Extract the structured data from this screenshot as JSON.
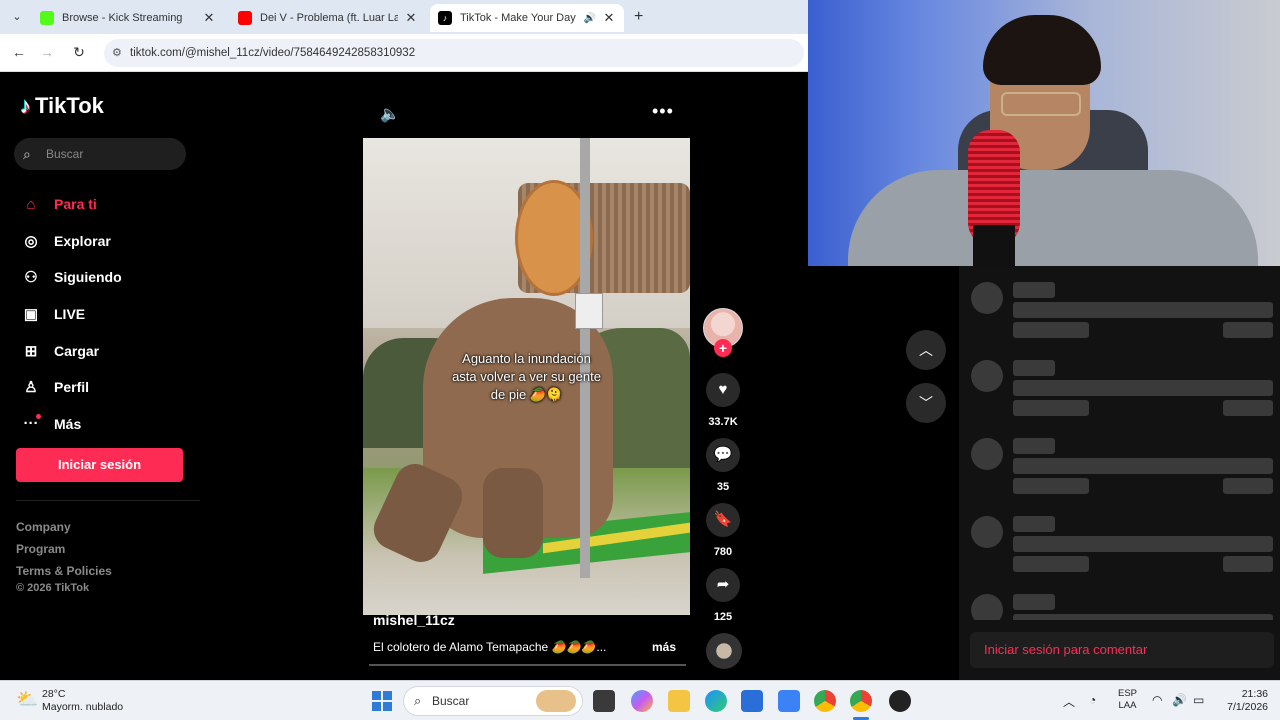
{
  "browser": {
    "tabs": [
      {
        "title": "Browse - Kick Streaming",
        "favicon_color": "#53fc18"
      },
      {
        "title": "Dei V - Problema (ft. Luar La L)",
        "favicon_color": "#ff0000"
      },
      {
        "title": "TikTok - Make Your Day",
        "favicon_color": "#000000",
        "active": true
      }
    ],
    "url": "tiktok.com/@mishel_11cz/video/7584649242858310932"
  },
  "tiktok": {
    "logo": "TikTok",
    "search_placeholder": "Buscar",
    "nav": [
      {
        "label": "Para ti",
        "icon": "home-icon",
        "active": true
      },
      {
        "label": "Explorar",
        "icon": "compass-icon"
      },
      {
        "label": "Siguiendo",
        "icon": "following-icon"
      },
      {
        "label": "LIVE",
        "icon": "live-icon"
      },
      {
        "label": "Cargar",
        "icon": "upload-icon"
      },
      {
        "label": "Perfil",
        "icon": "profile-icon"
      },
      {
        "label": "Más",
        "icon": "more-dots-icon"
      }
    ],
    "login_button": "Iniciar sesión",
    "footer": [
      "Company",
      "Program",
      "Terms & Policies"
    ],
    "copyright": "© 2026 TikTok"
  },
  "video": {
    "caption_line1": "Aguanto la inundación",
    "caption_line2": "asta volver a ver su gente",
    "caption_line3": "de pie 🥭🫠",
    "username": "mishel_11cz",
    "description": "El colotero de Alamo Temapache 🥭🥭🥭...",
    "more_label": "más",
    "likes": "33.7K",
    "comments": "35",
    "saves": "780",
    "shares": "125"
  },
  "comments_panel": {
    "login_prompt": "Iniciar sesión para comentar"
  },
  "taskbar": {
    "weather_temp": "28°C",
    "weather_desc": "Mayorm. nublado",
    "search_placeholder": "Buscar",
    "lang_line1": "ESP",
    "lang_line2": "LAA",
    "time": "21:36",
    "date": "7/1/2026"
  }
}
